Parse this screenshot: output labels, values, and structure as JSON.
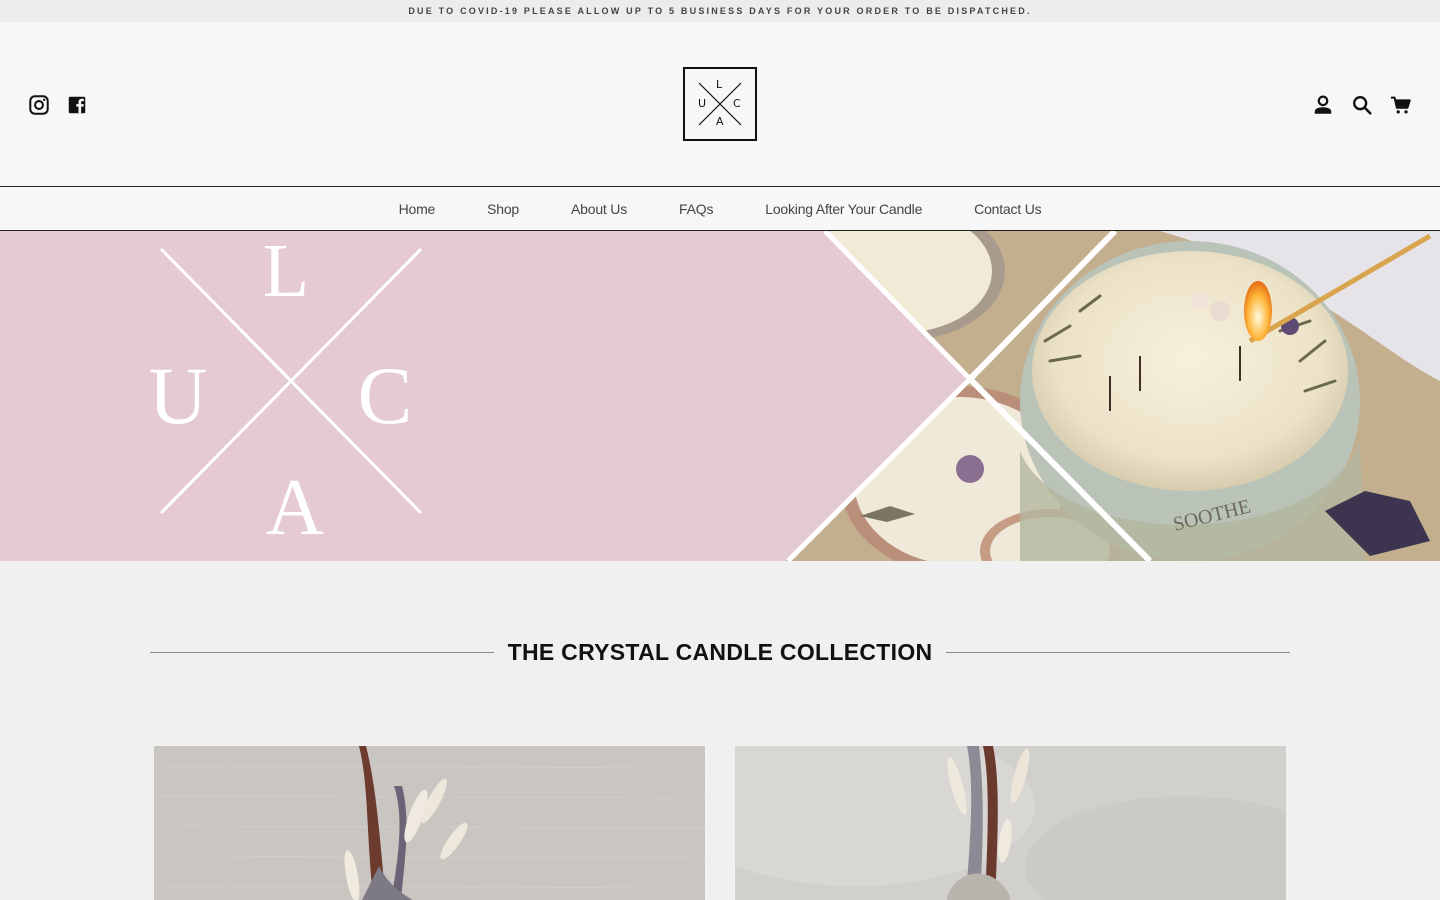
{
  "announcement": {
    "text": "DUE TO COVID-19 PLEASE ALLOW UP TO 5 BUSINESS DAYS FOR YOUR ORDER TO BE DISPATCHED."
  },
  "header": {
    "social_icons": [
      "instagram-icon",
      "facebook-icon"
    ],
    "utility_icons": [
      "account-icon",
      "search-icon",
      "cart-icon"
    ],
    "logo_letters": {
      "top": "L",
      "left": "U",
      "right": "C",
      "bottom": "A"
    }
  },
  "nav": {
    "items": [
      {
        "label": "Home"
      },
      {
        "label": "Shop"
      },
      {
        "label": "About Us"
      },
      {
        "label": "FAQs"
      },
      {
        "label": "Looking After Your Candle"
      },
      {
        "label": "Contact Us"
      }
    ]
  },
  "hero": {
    "monogram": {
      "top": "L",
      "left": "U",
      "right": "C",
      "bottom": "A"
    },
    "background_color": "#e5cad4"
  },
  "collection": {
    "title": "THE CRYSTAL CANDLE COLLECTION"
  },
  "colors": {
    "text": "#222222",
    "hero_pink": "#e5cad4",
    "page_bg": "#f0f0f0"
  }
}
